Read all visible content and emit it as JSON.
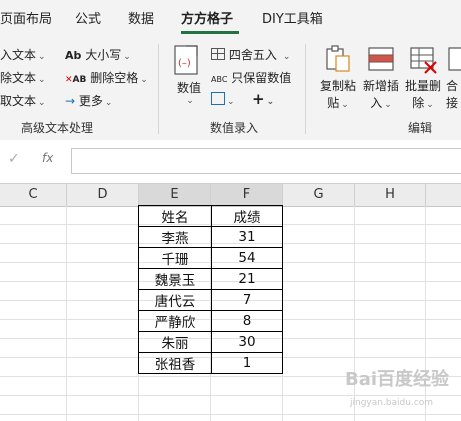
{
  "tabs": [
    "页面布局",
    "公式",
    "数据",
    "方方格子",
    "DIY工具箱"
  ],
  "ribbon": {
    "text_group": {
      "items": [
        "入文本",
        "除文本",
        "取文本"
      ],
      "case_label": "大小写",
      "case_prefix": "Ab",
      "delete_space_label": "删除空格",
      "more_label": "更多",
      "group_label": "高级文本处理"
    },
    "number_group": {
      "numeric_label": "数值",
      "round_label": "四舍五入",
      "keep_numbers_label": "只保留数值",
      "keep_numbers_prefix": "ABC",
      "group_label": "数值录入"
    },
    "edit_group": {
      "copy_paste_label_1": "复制粘",
      "copy_paste_label_2": "贴",
      "insert_label_1": "新增插",
      "insert_label_2": "入",
      "batch_delete_label_1": "批量删",
      "batch_delete_label_2": "除",
      "merge_label_1": "合",
      "merge_label_2": "接",
      "group_label": "编辑"
    }
  },
  "formula_bar": {
    "fx_label": "fx",
    "value": ""
  },
  "sheet": {
    "columns": [
      "C",
      "D",
      "E",
      "F",
      "G",
      "H"
    ],
    "table": [
      [
        "姓名",
        "成绩"
      ],
      [
        "李燕",
        "31"
      ],
      [
        "千珊",
        "54"
      ],
      [
        "魏景玉",
        "21"
      ],
      [
        "唐代云",
        "7"
      ],
      [
        "严静欣",
        "8"
      ],
      [
        "朱丽",
        "30"
      ],
      [
        "张祖香",
        "1"
      ]
    ]
  },
  "watermark": {
    "main": "Bai百度经验",
    "sub": "jingyan.baidu.com"
  }
}
